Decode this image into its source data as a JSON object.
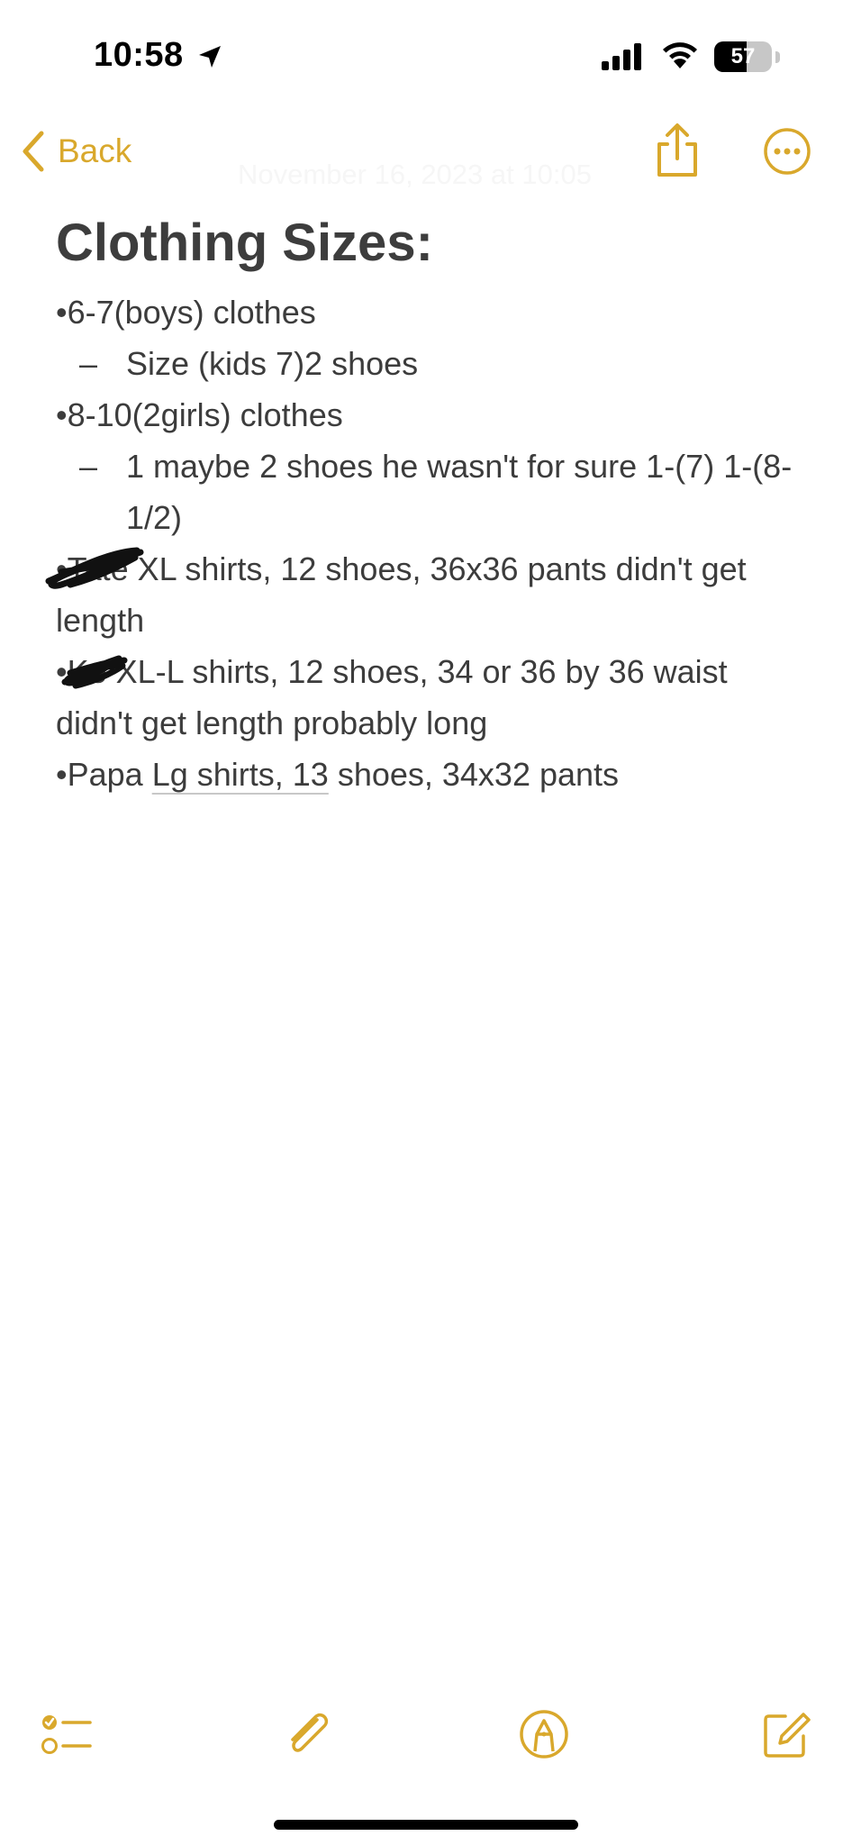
{
  "status_bar": {
    "time": "10:58",
    "battery_percent": "57",
    "battery_level": 0.57,
    "icons": [
      "location-arrow-icon",
      "cellular-signal-icon",
      "wifi-icon",
      "battery-icon"
    ]
  },
  "nav": {
    "back_label": "Back",
    "faded_date": "November 16, 2023 at 10:05",
    "icons": [
      "chevron-left-icon",
      "share-icon",
      "more-icon"
    ]
  },
  "note": {
    "title": "Clothing Sizes:",
    "lines": [
      "•6-7(boys) clothes",
      "Size (kids 7)2 shoes",
      "•8-10(2girls) clothes",
      "1 maybe 2 shoes he wasn't for sure 1-(7) 1-(8-1/2)",
      "•Tate XL shirts, 12 shoes, 36x36 pants didn't get length",
      "•Ke XL-L shirts, 12 shoes, 34 or 36 by 36 waist didn't get length probably long",
      "•Papa",
      "Lg shirts, 13",
      " shoes, 34x32 pants"
    ],
    "dash": "–"
  },
  "toolbar": {
    "icons": [
      "checklist-icon",
      "paperclip-icon",
      "markup-pen-icon",
      "compose-icon"
    ]
  },
  "colors": {
    "accent": "#d9a82c",
    "text": "#3c3c3c",
    "background": "#ffffff"
  }
}
